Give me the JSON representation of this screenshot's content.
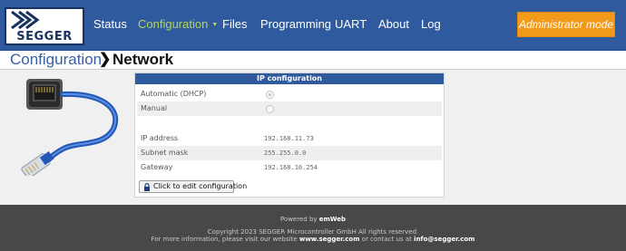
{
  "brand": {
    "logo_text": "SEGGER"
  },
  "nav": {
    "items": [
      {
        "label": "Status"
      },
      {
        "label": "Configuration"
      },
      {
        "label": "Files"
      },
      {
        "label": "Programming"
      },
      {
        "label": "UART"
      },
      {
        "label": "About"
      },
      {
        "label": "Log"
      }
    ],
    "admin_label": "Administrator mode",
    "active_color": "#b6d45b",
    "admin_color": "#f39a1b",
    "bar_color": "#2f5a9e"
  },
  "breadcrumb": {
    "parent": "Configuration",
    "separator": "❯",
    "current": "Network"
  },
  "panel": {
    "title": "IP configuration",
    "dhcp_label": "Automatic (DHCP)",
    "manual_label": "Manual",
    "selected_mode": "Automatic (DHCP)",
    "ip_label": "IP address",
    "ip_value": "192.168.11.73",
    "mask_label": "Subnet mask",
    "mask_value": "255.255.0.0",
    "gateway_label": "Gateway",
    "gateway_value": "192.168.10.254",
    "edit_button": "Click to edit configuration",
    "edit_icon": "lock-icon"
  },
  "footer": {
    "powered_prefix": "Powered by",
    "powered_brand": "emWeb",
    "copyright": "Copyright 2023 SEGGER Microcontroller GmbH All rights reserved.",
    "info_prefix": "For more information, please visit our website",
    "website": "www.segger.com",
    "info_middle": "or contact us at",
    "email": "info@segger.com"
  }
}
